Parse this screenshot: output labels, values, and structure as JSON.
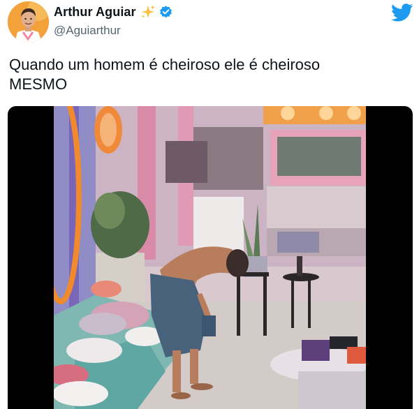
{
  "tweet": {
    "author": {
      "display_name": "Arthur Aguiar",
      "handle": "@Aguiarthur",
      "verified": true,
      "name_emoji": "sparkles-icon"
    },
    "text": "Quando um homem é cheiroso ele é cheiroso\nMESMO",
    "brand_icon": "twitter-icon",
    "media": {
      "type": "video",
      "description_icon": "video-frame"
    }
  },
  "colors": {
    "twitter_blue": "#1d9bf0",
    "text_primary": "#0f1419",
    "text_secondary": "#536471",
    "sparkle_yellow": "#f6c244",
    "letterbox": "#000000"
  }
}
